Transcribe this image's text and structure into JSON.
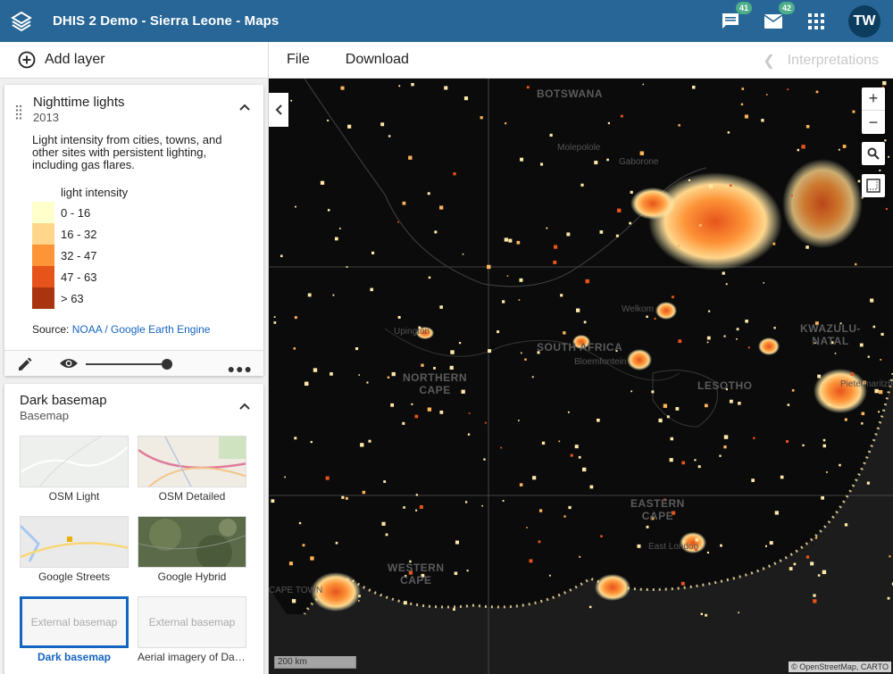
{
  "header": {
    "app_title": "DHIS 2 Demo - Sierra Leone - Maps",
    "messages_count": "41",
    "email_count": "42",
    "user_initials": "TW"
  },
  "toolbar": {
    "add_layer": "Add layer",
    "file": "File",
    "download": "Download",
    "interpretations": "Interpretations"
  },
  "layer_card": {
    "title": "Nighttime lights",
    "period": "2013",
    "description": "Light intensity from cities, towns, and other sites with persistent lighting, including gas flares.",
    "legend_title": "light intensity",
    "legend": [
      {
        "label": "0 - 16",
        "color": "#ffffcc"
      },
      {
        "label": "16 - 32",
        "color": "#ffd68b"
      },
      {
        "label": "32 - 47",
        "color": "#fd9438"
      },
      {
        "label": "47 - 63",
        "color": "#e6541b"
      },
      {
        "label": "> 63",
        "color": "#a8350f"
      }
    ],
    "source_label": "Source:",
    "source_link": "NOAA / Google Earth Engine",
    "opacity": 0.9
  },
  "basemap_card": {
    "title": "Dark basemap",
    "subtitle": "Basemap",
    "tiles": [
      {
        "label": "OSM Light"
      },
      {
        "label": "OSM Detailed"
      },
      {
        "label": "Google Streets"
      },
      {
        "label": "Google Hybrid"
      },
      {
        "label": "Dark basemap",
        "thumb": "External basemap",
        "selected": true
      },
      {
        "label": "Aerial imagery of Dar...",
        "thumb": "External basemap"
      }
    ]
  },
  "map": {
    "places": [
      "BOTSWANA",
      "SOUTH AFRICA",
      "NORTHERN\nCAPE",
      "LESOTHO",
      "KWAZULU-\nNATAL",
      "EASTERN\nCAPE",
      "WESTERN\nCAPE"
    ],
    "towns": [
      "Molepolole",
      "Gaborone",
      "Upington",
      "Bloemfontein",
      "Welkom",
      "East London",
      "Pietermaritzburg",
      "CAPE TOWN"
    ],
    "scale": "200 km",
    "attribution": "© OpenStreetMap, CARTO"
  }
}
